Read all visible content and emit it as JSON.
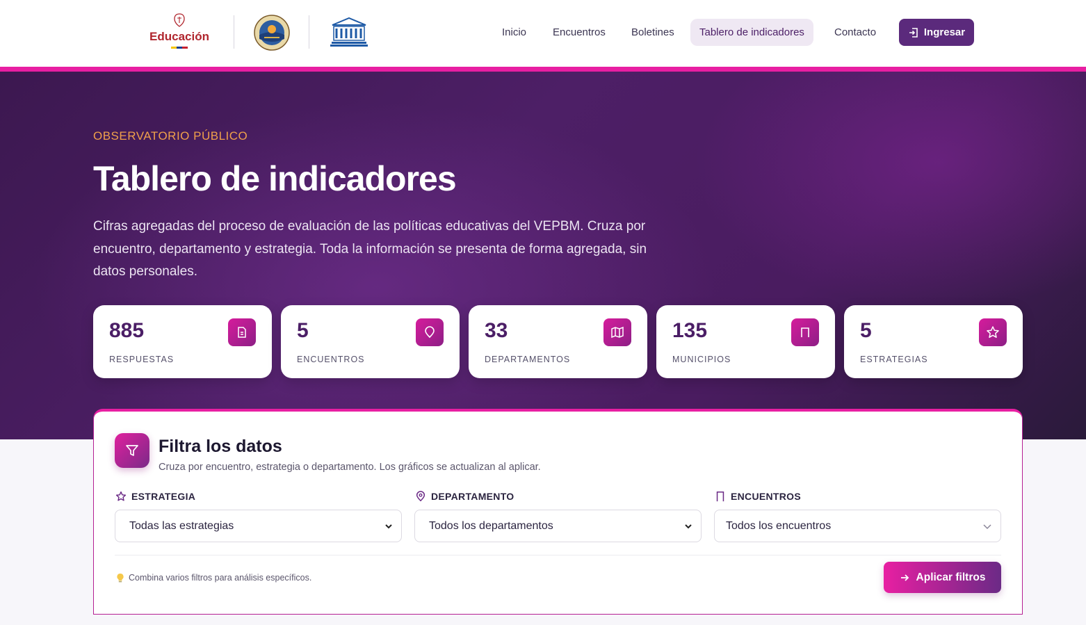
{
  "header": {
    "logo_education_text": "Educación",
    "nav": [
      {
        "label": "Inicio"
      },
      {
        "label": "Encuentros"
      },
      {
        "label": "Boletines"
      },
      {
        "label": "Tablero de indicadores",
        "active": true
      },
      {
        "label": "Contacto"
      }
    ],
    "login_label": "Ingresar",
    "accent_color": "#e81fa2",
    "brand_color": "#5b2a7c"
  },
  "hero": {
    "eyebrow": "OBSERVATORIO PÚBLICO",
    "title": "Tablero de indicadores",
    "description": "Cifras agregadas del proceso de evaluación de las políticas educativas del VEPBM. Cruza por encuentro, departamento y estrategia. Toda la información se presenta de forma agregada, sin datos personales."
  },
  "stats": [
    {
      "value": "885",
      "label": "RESPUESTAS",
      "icon": "document-icon"
    },
    {
      "value": "5",
      "label": "ENCUENTROS",
      "icon": "location-pin-icon"
    },
    {
      "value": "33",
      "label": "DEPARTAMENTOS",
      "icon": "map-icon"
    },
    {
      "value": "135",
      "label": "MUNICIPIOS",
      "icon": "bookmark-icon"
    },
    {
      "value": "5",
      "label": "ESTRATEGIAS",
      "icon": "star-icon"
    }
  ],
  "filters": {
    "title": "Filtra los datos",
    "subtitle": "Cruza por encuentro, estrategia o departamento. Los gráficos se actualizan al aplicar.",
    "strategy_label": "ESTRATEGIA",
    "strategy_value": "Todas las estrategias",
    "department_label": "DEPARTAMENTO",
    "department_value": "Todos los departamentos",
    "encounters_label": "ENCUENTROS",
    "encounters_value": "Todos los encuentros",
    "hint": "Combina varios filtros para análisis específicos.",
    "apply_label": "Aplicar filtros"
  }
}
